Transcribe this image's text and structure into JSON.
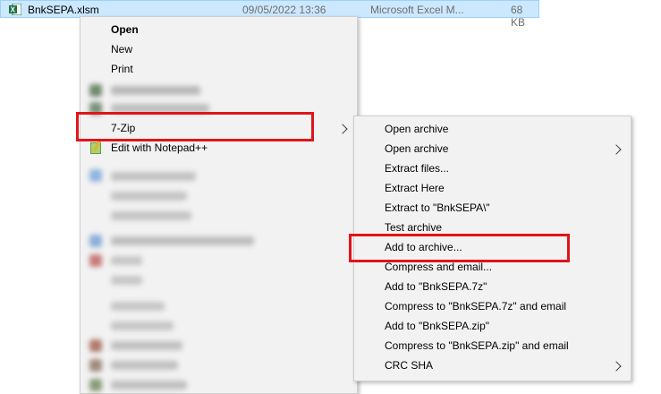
{
  "file": {
    "name": "BnkSEPA.xlsm",
    "date": "09/05/2022 13:36",
    "type": "Microsoft Excel M...",
    "size": "68 KB",
    "icon": "excel-icon"
  },
  "context_menu": {
    "open": "Open",
    "new": "New",
    "print": "Print",
    "sevenzip": "7-Zip",
    "notepad": "Edit with Notepad++"
  },
  "submenu": {
    "items": [
      "Open archive",
      "Open archive",
      "Extract files...",
      "Extract Here",
      "Extract to \"BnkSEPA\\\"",
      "Test archive",
      "Add to archive...",
      "Compress and email...",
      "Add to \"BnkSEPA.7z\"",
      "Compress to \"BnkSEPA.7z\" and email",
      "Add to \"BnkSEPA.zip\"",
      "Compress to \"BnkSEPA.zip\" and email",
      "CRC SHA"
    ]
  },
  "colors": {
    "highlight": "#e0141c",
    "selection": "#cce8ff",
    "menu_bg": "#f2f2f2"
  }
}
